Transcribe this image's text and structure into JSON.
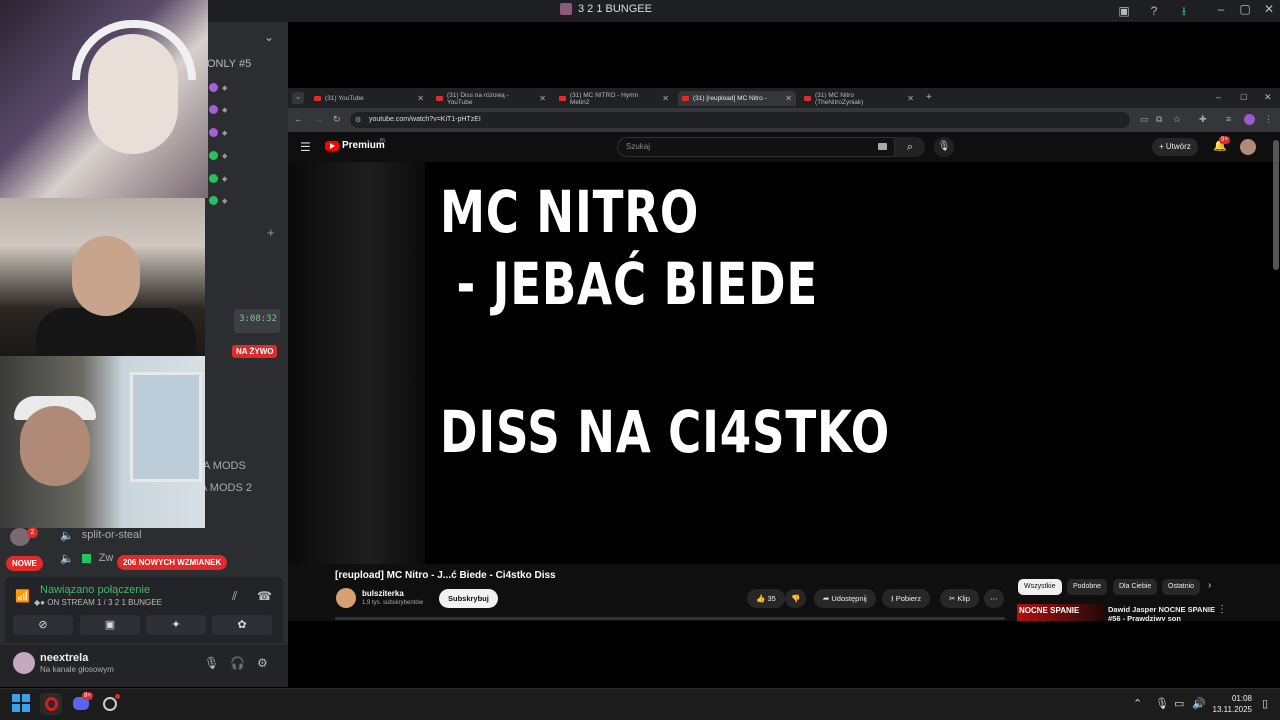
{
  "window": {
    "title": "3 2 1 BUNGEE"
  },
  "discord": {
    "channels_header": "ONLY #5",
    "stream_time": "3:08:32",
    "live_badge": "NA ŻYWO",
    "mods": [
      "A MODS",
      "A MODS 2"
    ],
    "voice_users": [
      {
        "name": "split-or-steal",
        "badge": "2"
      },
      {
        "name": "Zw"
      }
    ],
    "new_badge": "NOWE",
    "mentions_badge": "206 NOWYCH WZMIANEK",
    "voice_connected": "Nawiązano połączenie",
    "voice_channel": "ON STREAM 1 / 3 2 1 BUNGEE",
    "user": {
      "name": "neextrela",
      "status": "Na kanale głosowym"
    }
  },
  "browser": {
    "tabs": [
      {
        "label": "(31) YouTube",
        "active": false
      },
      {
        "label": "(31) Diss na różową - YouTube",
        "active": false
      },
      {
        "label": "(31) MC NITRO - Hymn Metin2",
        "active": false
      },
      {
        "label": "(31) [reupload] MC Nitro -",
        "active": true
      },
      {
        "label": "(31) MC Nitro (TheNitroZyniak)",
        "active": false
      }
    ],
    "url": "youtube.com/watch?v=KiT1-pHTzEI"
  },
  "youtube": {
    "logo": "Premium",
    "logo_region": "PL",
    "search_placeholder": "Szukaj",
    "create_label": "Utwórz",
    "bell_badge": "9+",
    "video_lines": [
      "MC NITRO",
      " - JEBAĆ BIEDE",
      "DISS NA CI4STKO"
    ],
    "video_title": "[reupload] MC Nitro - J...ć Biede - Ci4stko Diss",
    "channel": {
      "name": "bulsziterka",
      "subs": "1,9 tys. subskrybentów"
    },
    "subscribe_label": "Subskrybuj",
    "likes": "35",
    "share_label": "Udostępnij",
    "download_label": "Pobierz",
    "clip_label": "Klip",
    "chips": [
      "Wszystkie",
      "Podobne",
      "Dla Ciebie",
      "Ostatnio"
    ],
    "recommended": {
      "thumb_text": "NOCNE SPANIE",
      "title": "Dawid Jasper NOCNE SPANIE #56 - Prawdziwy son"
    }
  },
  "taskbar": {
    "time": "01:08",
    "date": "13.11.2025",
    "discord_badge": "9+"
  }
}
